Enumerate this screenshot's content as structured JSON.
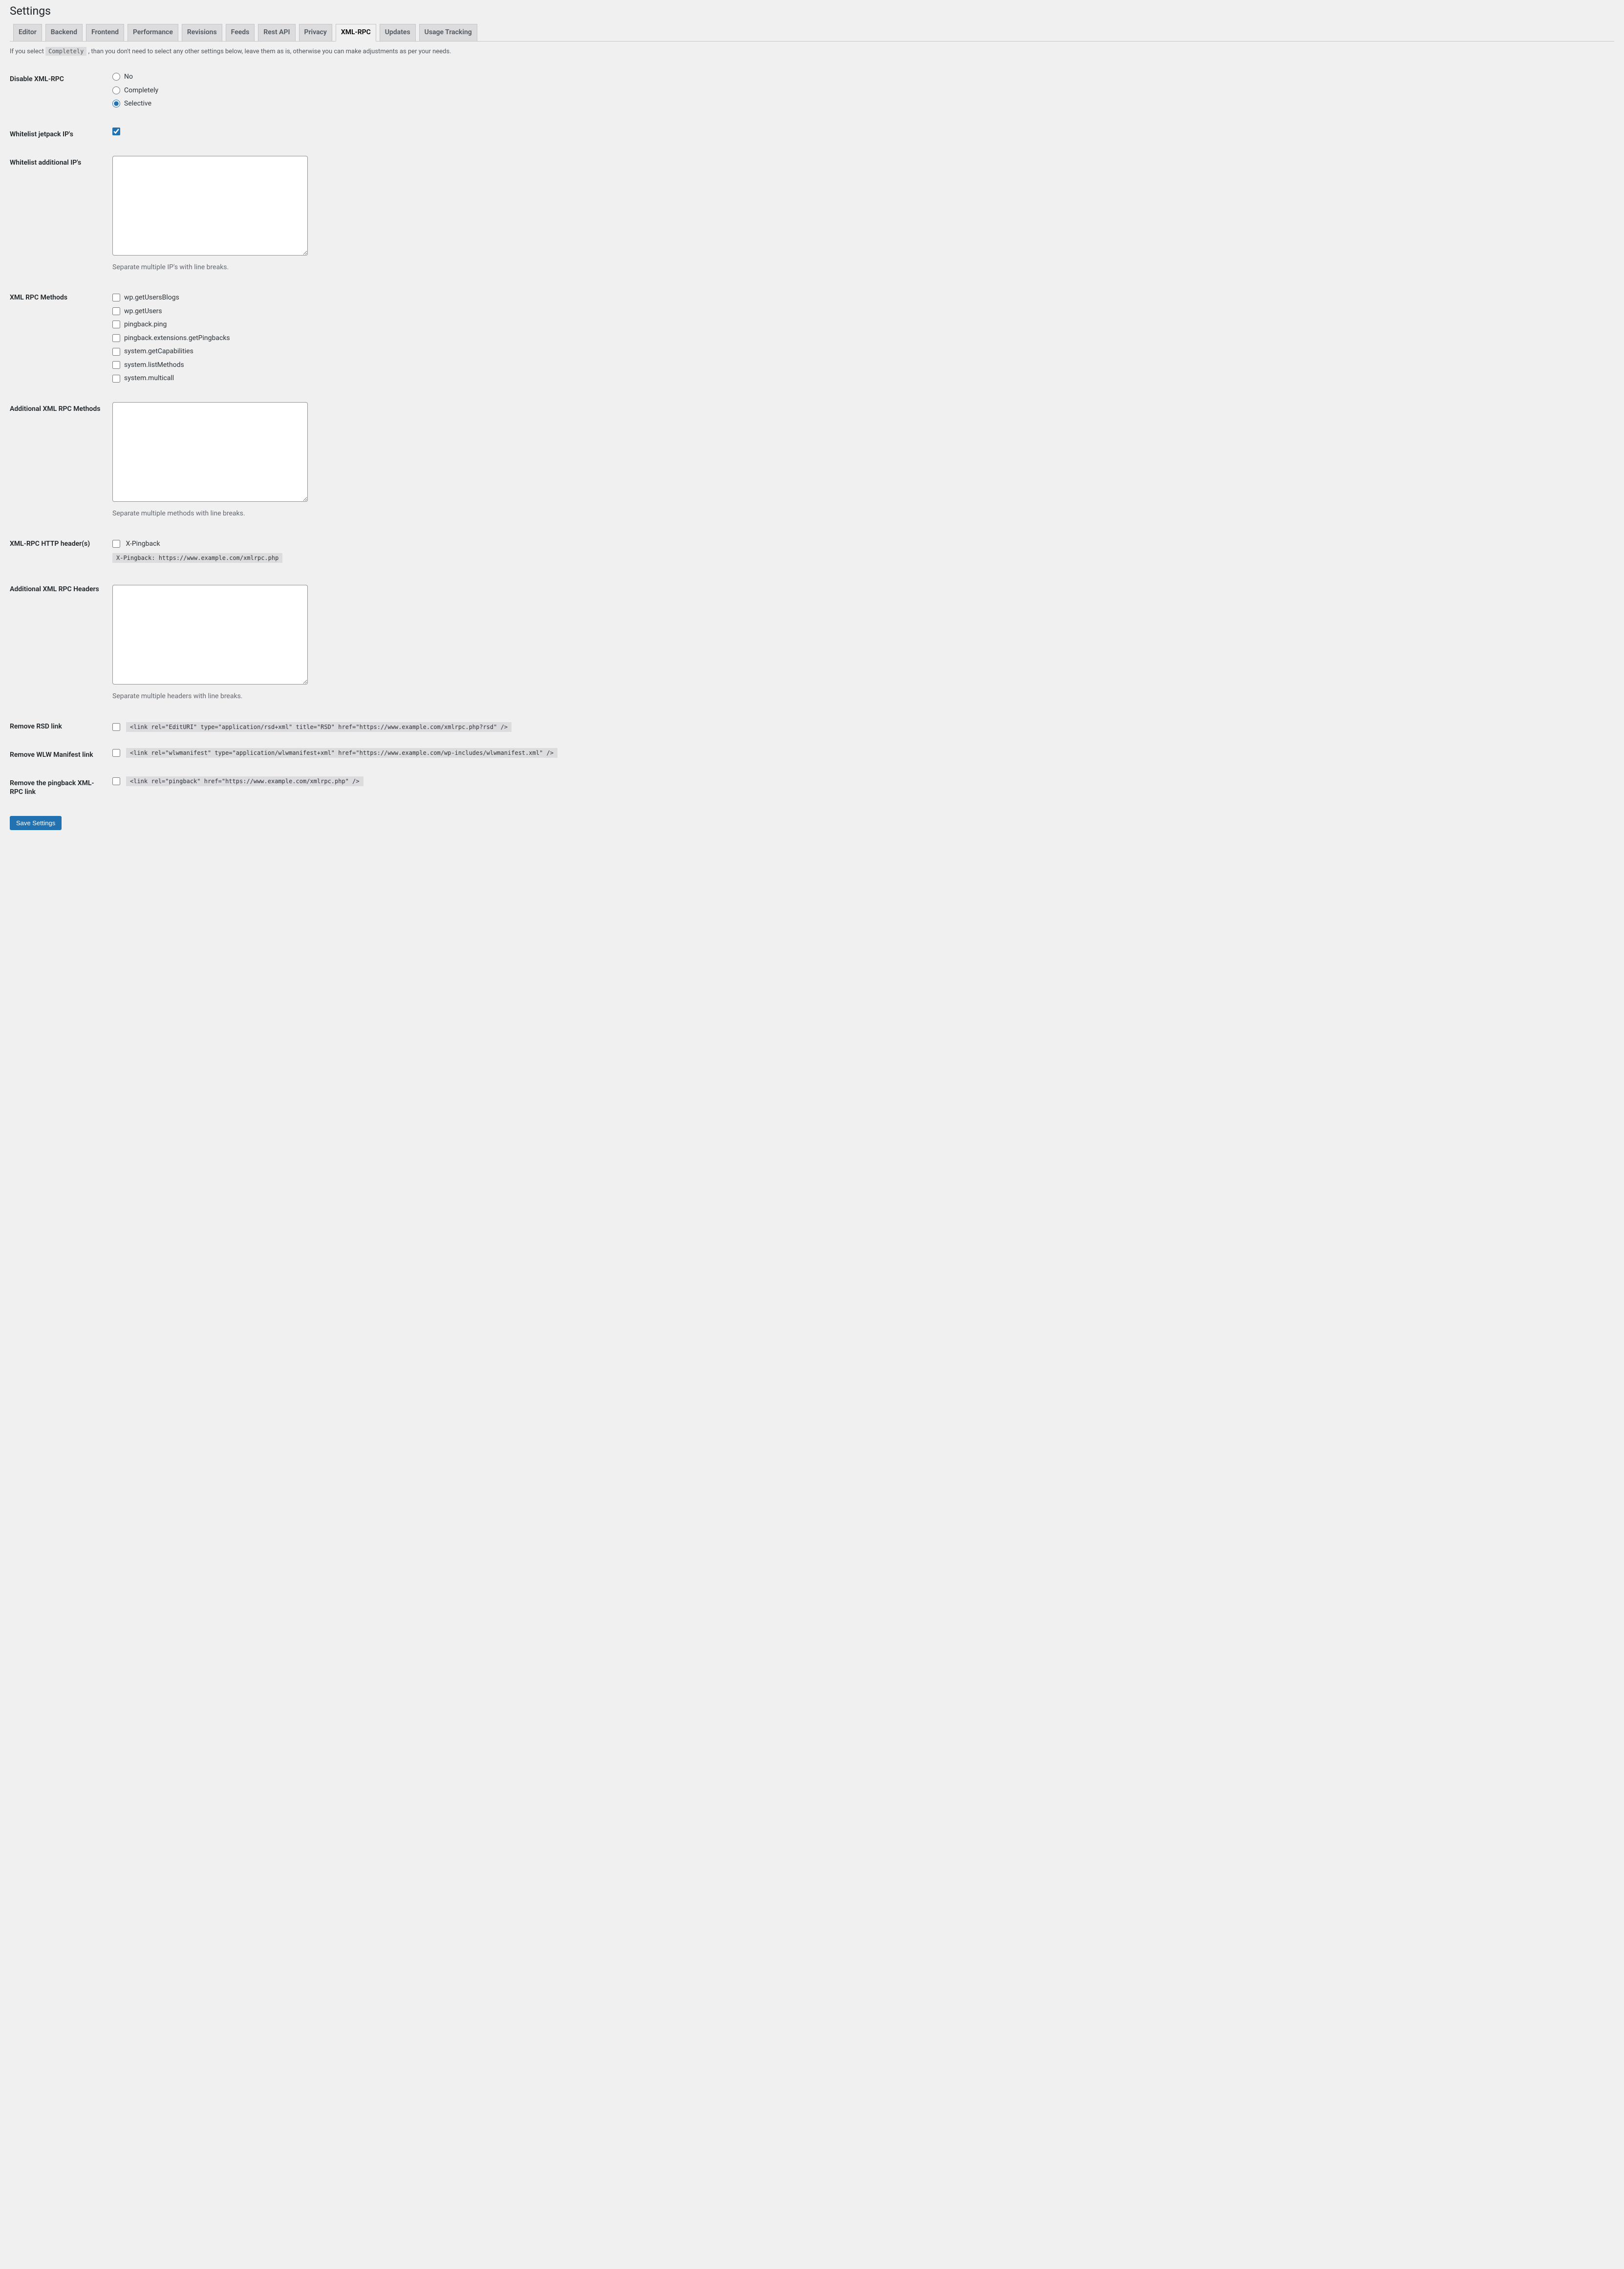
{
  "page_title": "Settings",
  "tabs": [
    {
      "label": "Editor"
    },
    {
      "label": "Backend"
    },
    {
      "label": "Frontend"
    },
    {
      "label": "Performance"
    },
    {
      "label": "Revisions"
    },
    {
      "label": "Feeds"
    },
    {
      "label": "Rest API"
    },
    {
      "label": "Privacy"
    },
    {
      "label": "XML-RPC"
    },
    {
      "label": "Updates"
    },
    {
      "label": "Usage Tracking"
    }
  ],
  "active_tab_index": 8,
  "intro": {
    "before": "If you select ",
    "code": "Completely",
    "after": " , than you don't need to select any other settings below, leave them as is, otherwise you can make adjustments as per your needs."
  },
  "fields": {
    "disable_xmlrpc": {
      "label": "Disable XML-RPC",
      "options": [
        "No",
        "Completely",
        "Selective"
      ],
      "selected": "Selective"
    },
    "whitelist_jetpack": {
      "label": "Whitelist jetpack IP's",
      "checked": true
    },
    "whitelist_additional": {
      "label": "Whitelist additional IP's",
      "value": "",
      "description": "Separate multiple IP's with line breaks."
    },
    "xmlrpc_methods": {
      "label": "XML RPC Methods",
      "options": [
        "wp.getUsersBlogs",
        "wp.getUsers",
        "pingback.ping",
        "pingback.extensions.getPingbacks",
        "system.getCapabilities",
        "system.listMethods",
        "system.multicall"
      ]
    },
    "additional_methods": {
      "label": "Additional XML RPC Methods",
      "value": "",
      "description": "Separate multiple methods with line breaks."
    },
    "http_headers": {
      "label": "XML-RPC HTTP header(s)",
      "option": "X-Pingback",
      "code": "X-Pingback: https://www.example.com/xmlrpc.php"
    },
    "additional_headers": {
      "label": "Additional XML RPC Headers",
      "value": "",
      "description": "Separate multiple headers with line breaks."
    },
    "remove_rsd": {
      "label": "Remove RSD link",
      "code": "<link rel=\"EditURI\" type=\"application/rsd+xml\" title=\"RSD\" href=\"https://www.example.com/xmlrpc.php?rsd\" />"
    },
    "remove_wlw": {
      "label": "Remove WLW Manifest link",
      "code": "<link rel=\"wlwmanifest\" type=\"application/wlwmanifest+xml\" href=\"https://www.example.com/wp-includes/wlwmanifest.xml\" />"
    },
    "remove_pingback": {
      "label": "Remove the pingback XML-RPC link",
      "code": "<link rel=\"pingback\" href=\"https://www.example.com/xmlrpc.php\" />"
    }
  },
  "save_button": "Save Settings"
}
